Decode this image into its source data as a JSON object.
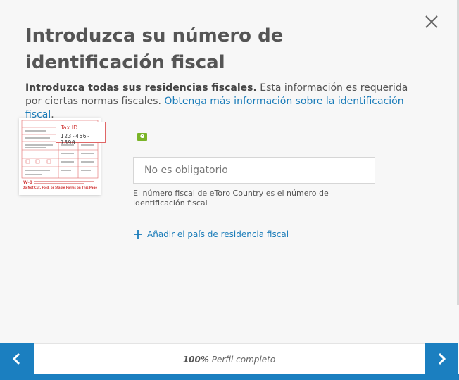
{
  "modal": {
    "title": "Introduzca su número de identificación fiscal",
    "intro_bold": "Introduzca todas sus residencias fiscales.",
    "intro_text": " Esta información es requerida por ciertas normas fiscales. ",
    "intro_link": "Obtenga más información sobre la identificación fiscal",
    "intro_end": "."
  },
  "illustration": {
    "badge_label": "Tax ID",
    "badge_number": "123-456-7890",
    "form_code": "W-9",
    "footer_text": "Do Not Cut, Fold, or Staple Forms on This Page"
  },
  "tax_field": {
    "country_flag_icon": "country-flag-icon",
    "placeholder": "No es obligatorio",
    "value": "",
    "hint": "El número fiscal de eToro Country es el número de identificación fiscal"
  },
  "add_country": {
    "label": "Añadir el país de residencia fiscal",
    "icon": "plus-icon"
  },
  "footer": {
    "percent": "100%",
    "label": " Perfil completo",
    "progress": 1.0,
    "accent_color": "#1b7fc0"
  },
  "icons": {
    "close": "close-icon",
    "prev": "chevron-left-icon",
    "next": "chevron-right-icon"
  }
}
